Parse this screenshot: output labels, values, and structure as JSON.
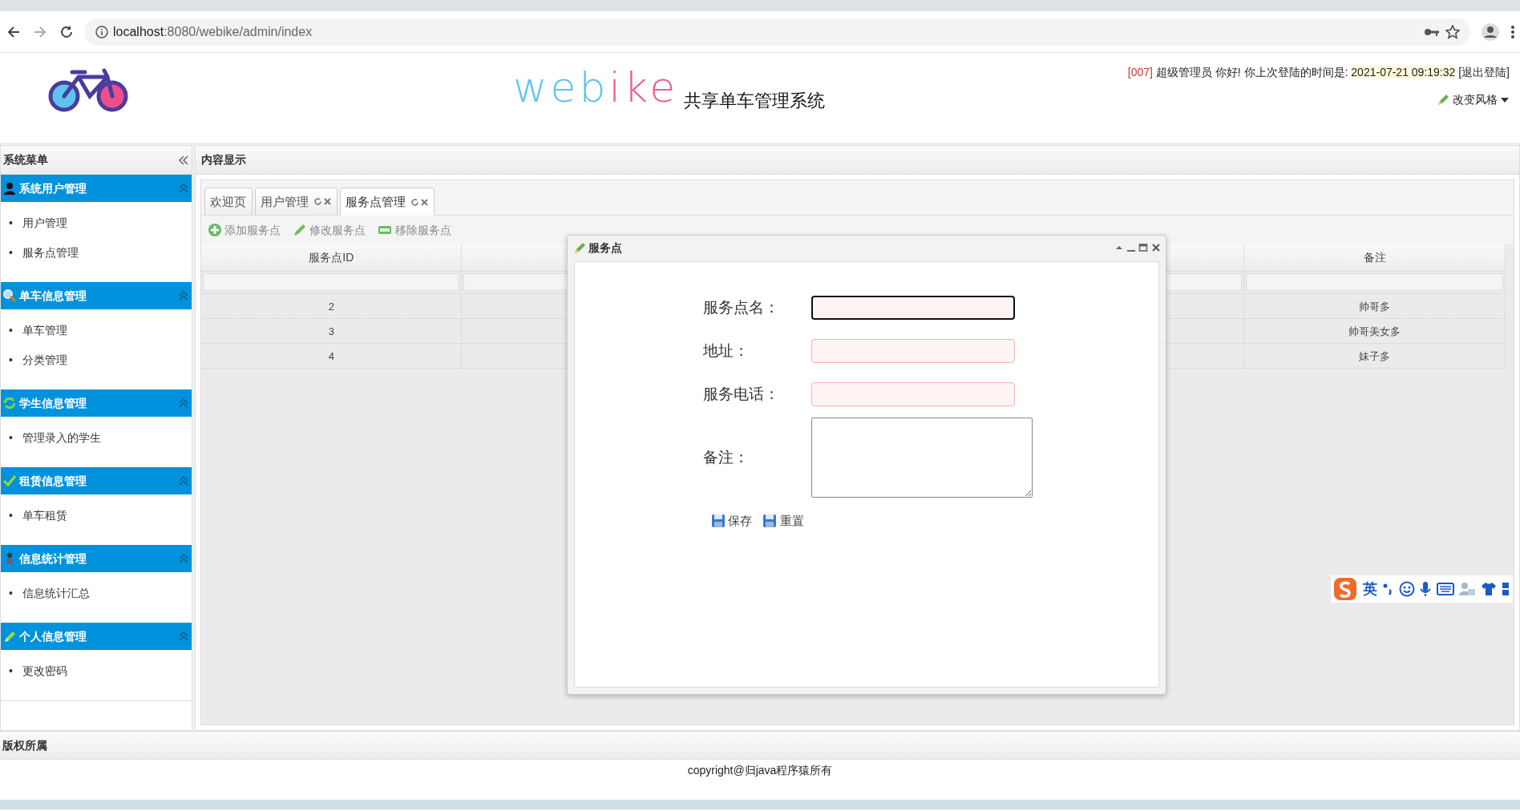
{
  "browser": {
    "url_host": "localhost",
    "url_path": ":8080/webike/admin/index"
  },
  "header": {
    "logo_text": [
      {
        "text": "web",
        "color": "#5ec4ee"
      },
      {
        "text": "ike",
        "color": "#ee5d94"
      }
    ],
    "subtitle": "共享单车管理系统",
    "user_id": "[007]",
    "greeting": "超级管理员 你好! 你上次登陆的时间是:",
    "last_login": "2021-07-21 09:19:32",
    "logout": "[退出登陆]",
    "style_menu": "改变风格"
  },
  "sidebar": {
    "title": "系统菜单",
    "sections": [
      {
        "title": "系统用户管理",
        "kind": "user",
        "expanded": true,
        "items": [
          {
            "bullet": "•",
            "label": "用户管理"
          },
          {
            "bullet": "•",
            "label": "服务点管理"
          }
        ]
      },
      {
        "title": "单车信息管理",
        "kind": "search",
        "expanded": true,
        "items": [
          {
            "bullet": "•",
            "label": "单车管理"
          },
          {
            "bullet": "•",
            "label": "分类管理"
          }
        ]
      },
      {
        "title": "学生信息管理",
        "kind": "sync",
        "expanded": true,
        "items": [
          {
            "bullet": "•",
            "label": "管理录入的学生"
          }
        ]
      },
      {
        "title": "租赁信息管理",
        "kind": "check",
        "expanded": true,
        "items": [
          {
            "bullet": "•",
            "label": "单车租赁"
          }
        ]
      },
      {
        "title": "信息统计管理",
        "kind": "stats",
        "expanded": true,
        "items": [
          {
            "bullet": "•",
            "label": "信息统计汇总"
          }
        ]
      },
      {
        "title": "个人信息管理",
        "kind": "edit",
        "expanded": true,
        "items": [
          {
            "bullet": "•",
            "label": "更改密码"
          }
        ]
      }
    ]
  },
  "content": {
    "title": "内容显示",
    "tabs": [
      {
        "label": "欢迎页",
        "closable": false,
        "selected": false
      },
      {
        "label": "用户管理",
        "closable": true,
        "selected": false
      },
      {
        "label": "服务点管理",
        "closable": true,
        "selected": true
      }
    ],
    "toolbar": [
      {
        "label": "添加服务点",
        "kind": "add"
      },
      {
        "label": "修改服务点",
        "kind": "edit"
      },
      {
        "label": "移除服务点",
        "kind": "remove"
      }
    ],
    "table": {
      "columns": [
        "服务点ID",
        "备注"
      ],
      "rows": [
        {
          "id": "2",
          "note": "帅哥多"
        },
        {
          "id": "3",
          "note": "帅哥美女多"
        },
        {
          "id": "4",
          "note": "妹子多"
        }
      ]
    }
  },
  "dialog": {
    "title": "服务点",
    "fields": [
      {
        "label": "服务点名：",
        "kind": "text",
        "focused": true,
        "invalid": true
      },
      {
        "label": "地址：",
        "kind": "text",
        "focused": false,
        "invalid": true
      },
      {
        "label": "服务电话：",
        "kind": "text",
        "focused": false,
        "invalid": true
      },
      {
        "label": "备注：",
        "kind": "textarea",
        "focused": false,
        "invalid": false
      }
    ],
    "buttons": [
      "保存",
      "重置"
    ]
  },
  "ime": {
    "mode": "英"
  },
  "footer": {
    "title": "版权所属",
    "text": "copyright@归java程序猿所有"
  }
}
